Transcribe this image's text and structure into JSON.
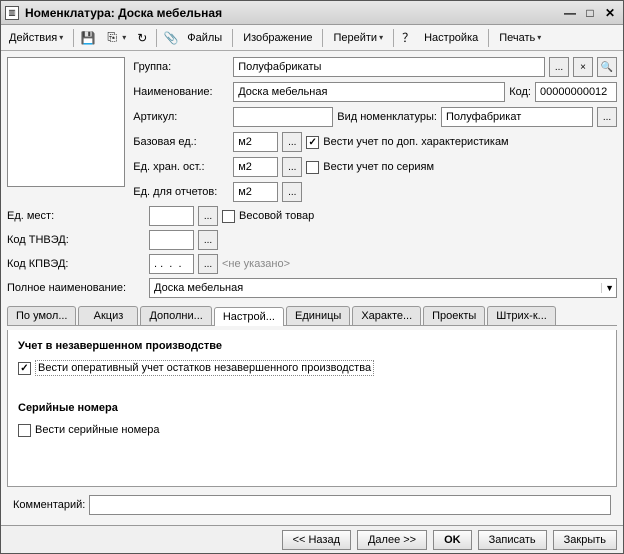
{
  "window": {
    "title": "Номенклатура: Доска мебельная"
  },
  "toolbar": {
    "actions": "Действия",
    "files": "Файлы",
    "image": "Изображение",
    "goto": "Перейти",
    "settings": "Настройка",
    "print": "Печать"
  },
  "fields": {
    "group_label": "Группа:",
    "group_value": "Полуфабрикаты",
    "name_label": "Наименование:",
    "name_value": "Доска мебельная",
    "code_label": "Код:",
    "code_value": "00000000012",
    "sku_label": "Артикул:",
    "sku_value": "",
    "nom_type_label": "Вид номенклатуры:",
    "nom_type_value": "Полуфабрикат",
    "base_unit_label": "Базовая ед.:",
    "base_unit_value": "м2",
    "addl_chars_label": "Вести учет по доп. характеристикам",
    "stor_unit_label": "Ед. хран. ост.:",
    "stor_unit_value": "м2",
    "series_label": "Вести учет по сериям",
    "rep_unit_label": "Ед. для отчетов:",
    "rep_unit_value": "м2",
    "place_unit_label": "Ед. мест:",
    "place_unit_value": "",
    "weight_label": "Весовой товар",
    "tnved_label": "Код ТНВЭД:",
    "tnved_value": "",
    "kpved_label": "Код КПВЭД:",
    "kpved_value": ". .  .  . ",
    "kpved_hint": "<не указано>",
    "fullname_label": "Полное наименование:",
    "fullname_value": "Доска мебельная"
  },
  "tabs": {
    "t0": "По умол...",
    "t1": "Акциз",
    "t2": "Дополни...",
    "t3": "Настрой...",
    "t4": "Единицы",
    "t5": "Характе...",
    "t6": "Проекты",
    "t7": "Штрих-к..."
  },
  "tabbody": {
    "section1": "Учет в незавершенном производстве",
    "chk1": "Вести оперативный учет остатков незавершенного производства",
    "section2": "Серийные номера",
    "chk2": "Вести серийные номера"
  },
  "footer": {
    "comment_label": "Комментарий:",
    "comment_value": ""
  },
  "buttons": {
    "back": "<< Назад",
    "next": "Далее >>",
    "ok": "OK",
    "save": "Записать",
    "close": "Закрыть"
  }
}
